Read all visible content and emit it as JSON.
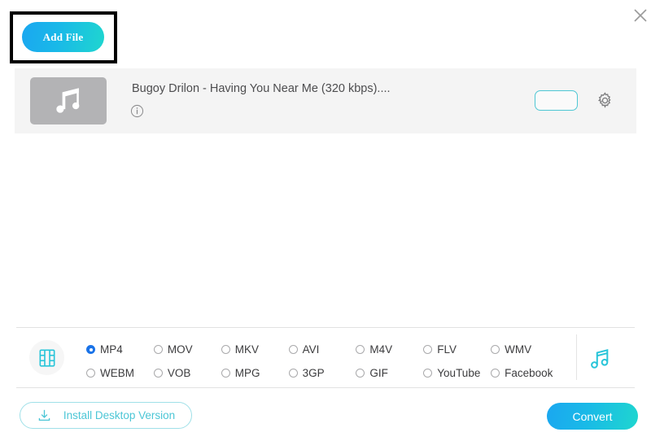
{
  "window": {
    "close_label": "×",
    "close_icon": "close-icon"
  },
  "toolbar": {
    "add_file_label": "Add File",
    "add_file_icon": "add-file-button",
    "highlight_color": "#000000",
    "accent_gradient_from": "#1aa7f0",
    "accent_gradient_to": "#1fd6cf"
  },
  "file_list": {
    "items": [
      {
        "name": "Bugoy Drilon - Having You Near Me (320 kbps)....",
        "thumb_icon": "music-note-icon",
        "info_icon": "info-icon",
        "format_value": "",
        "settings_icon": "gear-icon",
        "row_background": "#f4f4f4",
        "thumb_background": "#b3b3b5"
      }
    ]
  },
  "format_bar": {
    "media_type_icon": "film-strip-icon",
    "audio_icon": "music-note-icon",
    "accent_color": "#29c5d9",
    "selected_format": "MP4",
    "selected_radio_color": "#1a73e8",
    "formats": [
      {
        "label": "MP4",
        "selected": true
      },
      {
        "label": "MOV",
        "selected": false
      },
      {
        "label": "MKV",
        "selected": false
      },
      {
        "label": "AVI",
        "selected": false
      },
      {
        "label": "M4V",
        "selected": false
      },
      {
        "label": "FLV",
        "selected": false
      },
      {
        "label": "WMV",
        "selected": false
      },
      {
        "label": "WEBM",
        "selected": false
      },
      {
        "label": "VOB",
        "selected": false
      },
      {
        "label": "MPG",
        "selected": false
      },
      {
        "label": "3GP",
        "selected": false
      },
      {
        "label": "GIF",
        "selected": false
      },
      {
        "label": "YouTube",
        "selected": false
      },
      {
        "label": "Facebook",
        "selected": false
      }
    ]
  },
  "footer": {
    "install_label": "Install Desktop Version",
    "install_icon": "download-icon",
    "install_accent": "#4cc6d6",
    "convert_label": "Convert"
  }
}
